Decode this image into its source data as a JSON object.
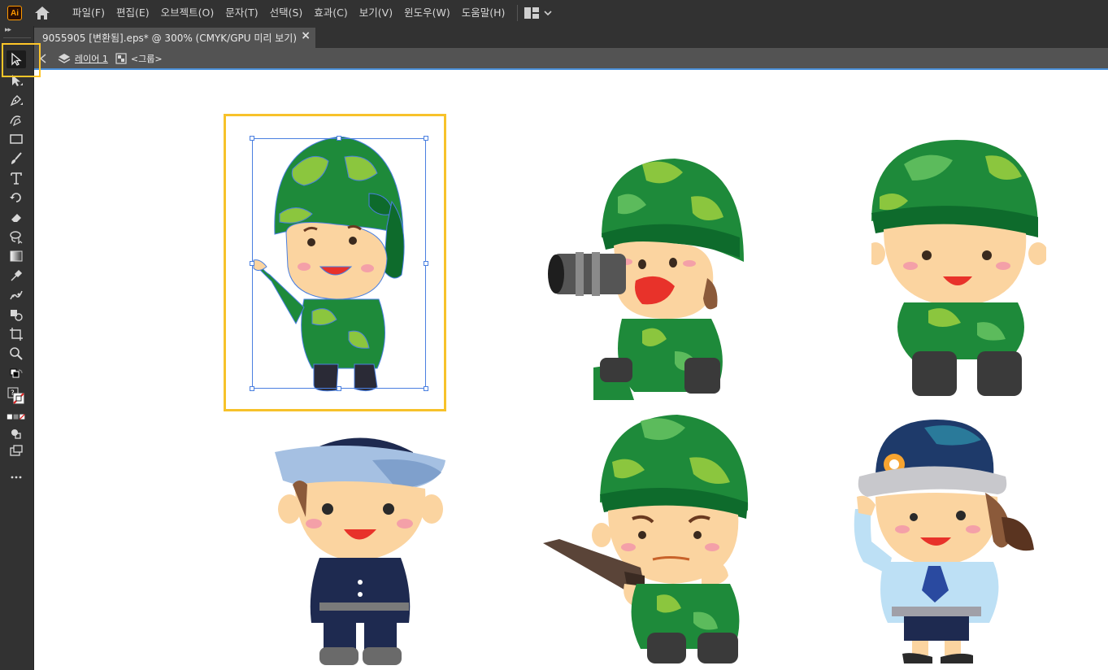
{
  "app": {
    "logo_text": "Ai",
    "menus": [
      "파일(F)",
      "편집(E)",
      "오브젝트(O)",
      "문자(T)",
      "선택(S)",
      "효과(C)",
      "보기(V)",
      "윈도우(W)",
      "도움말(H)"
    ]
  },
  "document_tab": {
    "title": "9055905 [변환됨].eps* @ 300% (CMYK/GPU 미리 보기)",
    "close_glyph": "×"
  },
  "breadcrumb": {
    "layer": "레이어 1",
    "group": "<그룹>"
  },
  "colors": {
    "chrome_dark": "#323232",
    "chrome_mid": "#535353",
    "highlight_yellow": "#f7c22a",
    "selection_blue": "#4a7fe0"
  },
  "characters": [
    {
      "name": "soldier-pointing",
      "selected": true
    },
    {
      "name": "soldier-bazooka"
    },
    {
      "name": "soldier-standing"
    },
    {
      "name": "sailor"
    },
    {
      "name": "soldier-rifle"
    },
    {
      "name": "policewoman"
    }
  ]
}
